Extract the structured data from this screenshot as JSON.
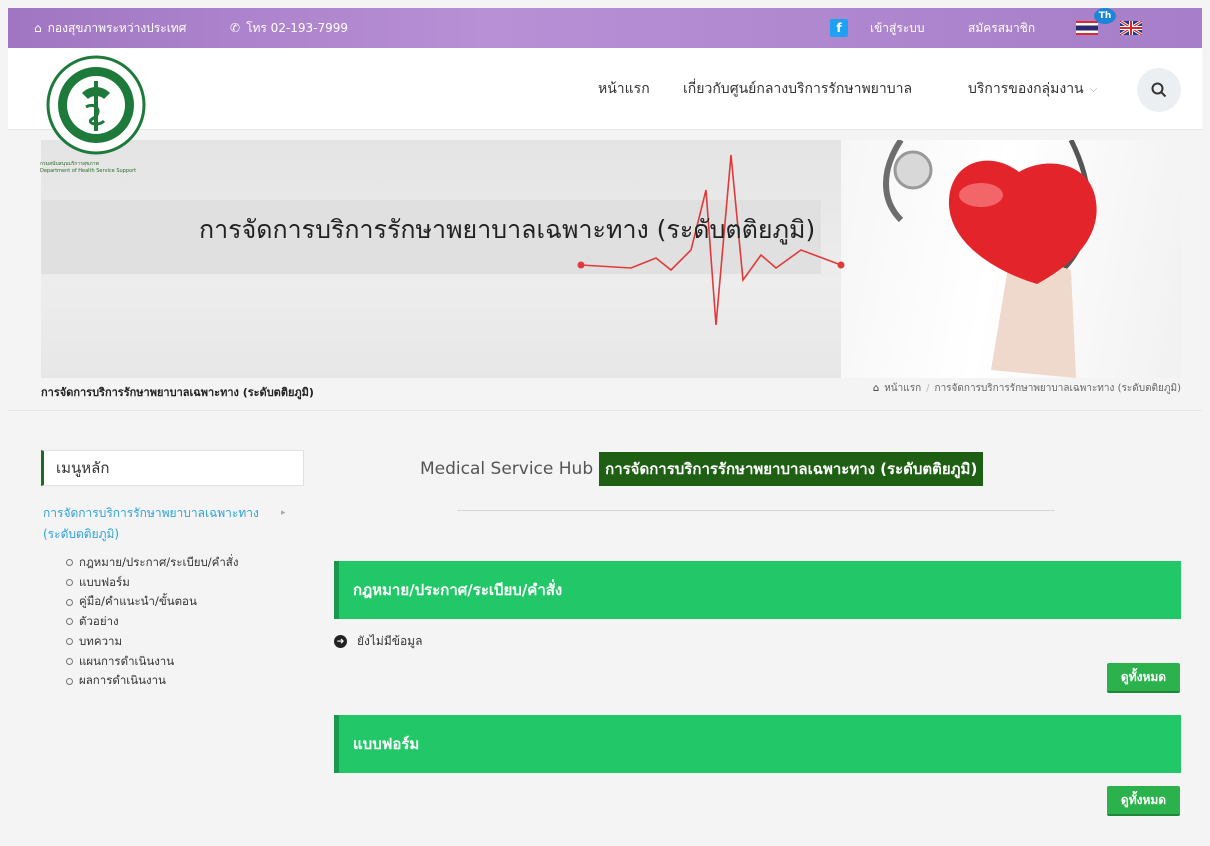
{
  "topbar": {
    "org_label": "กองสุขภาพระหว่างประเทศ",
    "phone_label": "โทร 02-193-7999",
    "facebook_icon": "f",
    "login_label": "เข้าสู่ระบบ",
    "register_label": "สมัครสมาชิก",
    "lang_badge": "Th"
  },
  "nav": {
    "items": [
      "หน้าแรก",
      "เกี่ยวกับศูนย์กลางบริการรักษาพยาบาล",
      "บริการของกลุ่มงาน"
    ]
  },
  "logo": {
    "line1": "กรมสนับสนุนบริการสุขภาพ",
    "line2": "Department of Health Service Support"
  },
  "banner": {
    "title": "การจัดการบริการรักษาพยาบาลเฉพาะทาง (ระดับตติยภูมิ)"
  },
  "page_header": {
    "title": "การจัดการบริการรักษาพยาบาลเฉพาะทาง (ระดับตติยภูมิ)",
    "breadcrumb": [
      "หน้าแรก",
      "การจัดการบริการรักษาพยาบาลเฉพาะทาง (ระดับตติยภูมิ)"
    ]
  },
  "sidebar": {
    "heading": "เมนูหลัก",
    "main_item": "การจัดการบริการรักษาพยาบาลเฉพาะทาง (ระดับตติยภูมิ)",
    "sub_items": [
      "กฎหมาย/ประกาศ/ระเบียบ/คำสั่ง",
      "แบบฟอร์ม",
      "คู่มือ/คำแนะนำ/ขั้นตอน",
      "ตัวอย่าง",
      "บทความ",
      "แผนการดำเนินงาน",
      "ผลการดำเนินงาน"
    ]
  },
  "main": {
    "hub_en": "Medical Service Hub",
    "hub_th": "การจัดการบริการรักษาพยาบาลเฉพาะทาง (ระดับตติยภูมิ)",
    "sections": [
      {
        "title": "กฎหมาย/ประกาศ/ระเบียบ/คำสั่ง",
        "empty_text": "ยังไม่มีข้อมูล",
        "button": "ดูทั้งหมด"
      },
      {
        "title": "แบบฟอร์ม",
        "button": "ดูทั้งหมด"
      }
    ]
  },
  "colors": {
    "topbar": "#a97fcc",
    "panel_green": "#22c868",
    "hub_green": "#1e5f13",
    "link_blue": "#2ea3d6"
  }
}
